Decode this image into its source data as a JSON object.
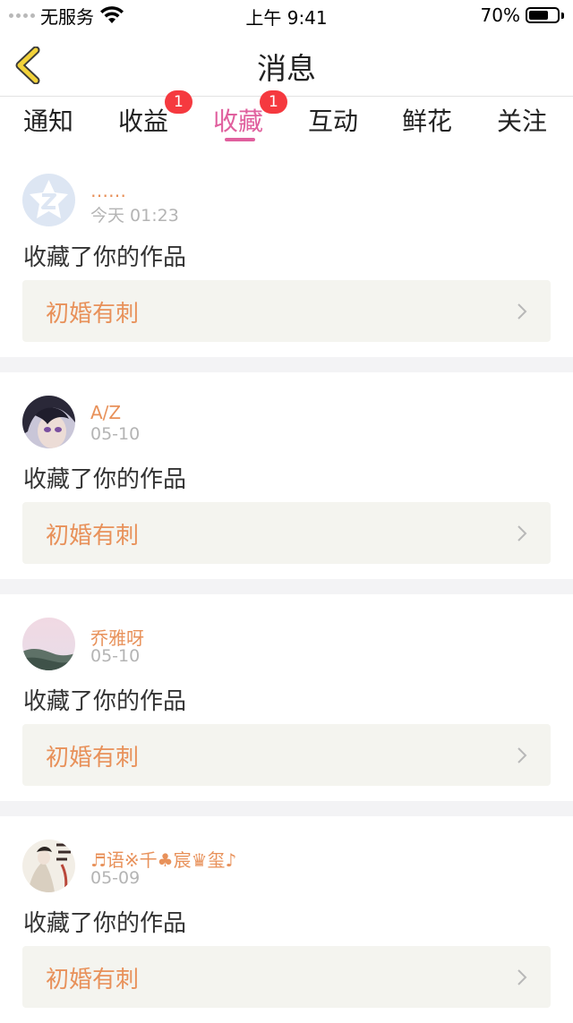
{
  "status_bar": {
    "carrier": "无服务",
    "time": "上午 9:41",
    "battery": "70%",
    "battery_level": 0.7,
    "icons": [
      "signal-dots-icon",
      "wifi-icon",
      "battery-icon"
    ]
  },
  "nav": {
    "title": "消息",
    "back_icon": "chevron-left-icon",
    "accent_back_color": "#f2d23a"
  },
  "tabs": [
    {
      "label": "通知"
    },
    {
      "label": "收益",
      "badge": "1"
    },
    {
      "label": "收藏",
      "badge": "1",
      "active": true
    },
    {
      "label": "互动"
    },
    {
      "label": "鲜花"
    },
    {
      "label": "关注"
    }
  ],
  "colors": {
    "active_tab": "#e0609e",
    "badge": "#f5393f",
    "username": "#e8915a",
    "work_title": "#e8915a",
    "separator": "#f3f3f5"
  },
  "messages": [
    {
      "user": "……",
      "time": "今天 01:23",
      "text": "收藏了你的作品",
      "work": "初婚有刺",
      "avatar": "default-avatar-icon"
    },
    {
      "user": "A/Z",
      "time": "05-10",
      "text": "收藏了你的作品",
      "work": "初婚有刺",
      "avatar": "anime-avatar"
    },
    {
      "user": "乔雅呀",
      "time": "05-10",
      "text": "收藏了你的作品",
      "work": "初婚有刺",
      "avatar": "landscape-avatar"
    },
    {
      "user": "♬语※千♣宸♛玺♪",
      "time": "05-09",
      "text": "收藏了你的作品",
      "work": "初婚有刺",
      "avatar": "book-cover-avatar"
    }
  ]
}
